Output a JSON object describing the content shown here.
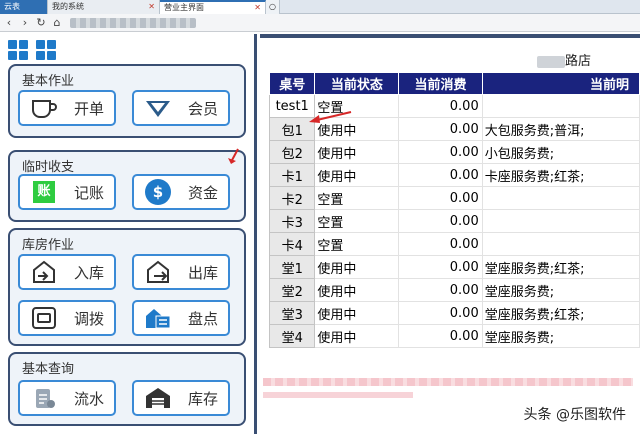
{
  "browser": {
    "tabs": [
      {
        "label": "云表"
      },
      {
        "label": "我的系统"
      },
      {
        "label": "营业主界面"
      }
    ]
  },
  "sidebar": {
    "groups": [
      {
        "title": "基本作业",
        "buttons": [
          {
            "label": "开单",
            "icon": "coffee-cup-icon"
          },
          {
            "label": "会员",
            "icon": "diamond-icon"
          }
        ]
      },
      {
        "title": "临时收支",
        "buttons": [
          {
            "label": "记账",
            "icon": "ledger-icon",
            "icon_text": "账"
          },
          {
            "label": "资金",
            "icon": "dollar-coin-icon",
            "icon_text": "$"
          }
        ]
      },
      {
        "title": "库房作业",
        "buttons": [
          {
            "label": "入库",
            "icon": "stock-in-icon"
          },
          {
            "label": "出库",
            "icon": "stock-out-icon"
          },
          {
            "label": "调拨",
            "icon": "transfer-icon"
          },
          {
            "label": "盘点",
            "icon": "inventory-count-icon"
          }
        ]
      },
      {
        "title": "基本查询",
        "buttons": [
          {
            "label": "流水",
            "icon": "journal-icon"
          },
          {
            "label": "库存",
            "icon": "warehouse-icon"
          }
        ]
      }
    ]
  },
  "main": {
    "shop_name_visible": "路店",
    "table": {
      "headers": [
        "桌号",
        "当前状态",
        "当前消费",
        "当前明"
      ],
      "rows": [
        {
          "table": "test1",
          "status": "空置",
          "amount": "0.00",
          "detail": ""
        },
        {
          "table": "包1",
          "status": "使用中",
          "amount": "0.00",
          "detail": "大包服务费;普洱;"
        },
        {
          "table": "包2",
          "status": "使用中",
          "amount": "0.00",
          "detail": "小包服务费;"
        },
        {
          "table": "卡1",
          "status": "使用中",
          "amount": "0.00",
          "detail": "卡座服务费;红茶;"
        },
        {
          "table": "卡2",
          "status": "空置",
          "amount": "0.00",
          "detail": ""
        },
        {
          "table": "卡3",
          "status": "空置",
          "amount": "0.00",
          "detail": ""
        },
        {
          "table": "卡4",
          "status": "空置",
          "amount": "0.00",
          "detail": ""
        },
        {
          "table": "堂1",
          "status": "使用中",
          "amount": "0.00",
          "detail": "堂座服务费;红茶;"
        },
        {
          "table": "堂2",
          "status": "使用中",
          "amount": "0.00",
          "detail": "堂座服务费;"
        },
        {
          "table": "堂3",
          "status": "使用中",
          "amount": "0.00",
          "detail": "堂座服务费;红茶;"
        },
        {
          "table": "堂4",
          "status": "使用中",
          "amount": "0.00",
          "detail": "堂座服务费;"
        }
      ]
    }
  },
  "watermark": "头条 @乐图软件",
  "colors": {
    "header_bg": "#1a237e",
    "group_border": "#3a4f73",
    "button_border": "#3a8ad6",
    "accent_blue": "#1f7ac9"
  }
}
